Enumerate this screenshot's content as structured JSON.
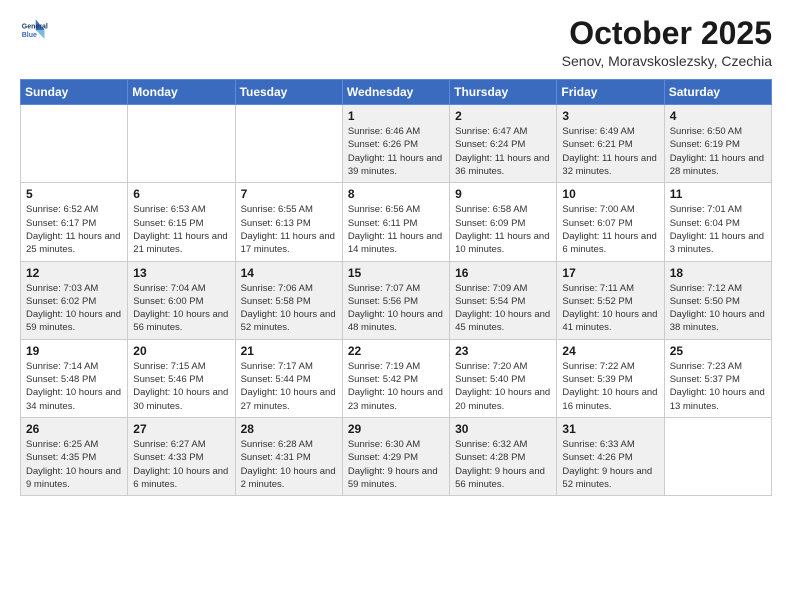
{
  "header": {
    "logo_line1": "General",
    "logo_line2": "Blue",
    "month": "October 2025",
    "location": "Senov, Moravskoslezsky, Czechia"
  },
  "weekdays": [
    "Sunday",
    "Monday",
    "Tuesday",
    "Wednesday",
    "Thursday",
    "Friday",
    "Saturday"
  ],
  "weeks": [
    [
      {
        "day": "",
        "info": ""
      },
      {
        "day": "",
        "info": ""
      },
      {
        "day": "",
        "info": ""
      },
      {
        "day": "1",
        "info": "Sunrise: 6:46 AM\nSunset: 6:26 PM\nDaylight: 11 hours\nand 39 minutes."
      },
      {
        "day": "2",
        "info": "Sunrise: 6:47 AM\nSunset: 6:24 PM\nDaylight: 11 hours\nand 36 minutes."
      },
      {
        "day": "3",
        "info": "Sunrise: 6:49 AM\nSunset: 6:21 PM\nDaylight: 11 hours\nand 32 minutes."
      },
      {
        "day": "4",
        "info": "Sunrise: 6:50 AM\nSunset: 6:19 PM\nDaylight: 11 hours\nand 28 minutes."
      }
    ],
    [
      {
        "day": "5",
        "info": "Sunrise: 6:52 AM\nSunset: 6:17 PM\nDaylight: 11 hours\nand 25 minutes."
      },
      {
        "day": "6",
        "info": "Sunrise: 6:53 AM\nSunset: 6:15 PM\nDaylight: 11 hours\nand 21 minutes."
      },
      {
        "day": "7",
        "info": "Sunrise: 6:55 AM\nSunset: 6:13 PM\nDaylight: 11 hours\nand 17 minutes."
      },
      {
        "day": "8",
        "info": "Sunrise: 6:56 AM\nSunset: 6:11 PM\nDaylight: 11 hours\nand 14 minutes."
      },
      {
        "day": "9",
        "info": "Sunrise: 6:58 AM\nSunset: 6:09 PM\nDaylight: 11 hours\nand 10 minutes."
      },
      {
        "day": "10",
        "info": "Sunrise: 7:00 AM\nSunset: 6:07 PM\nDaylight: 11 hours\nand 6 minutes."
      },
      {
        "day": "11",
        "info": "Sunrise: 7:01 AM\nSunset: 6:04 PM\nDaylight: 11 hours\nand 3 minutes."
      }
    ],
    [
      {
        "day": "12",
        "info": "Sunrise: 7:03 AM\nSunset: 6:02 PM\nDaylight: 10 hours\nand 59 minutes."
      },
      {
        "day": "13",
        "info": "Sunrise: 7:04 AM\nSunset: 6:00 PM\nDaylight: 10 hours\nand 56 minutes."
      },
      {
        "day": "14",
        "info": "Sunrise: 7:06 AM\nSunset: 5:58 PM\nDaylight: 10 hours\nand 52 minutes."
      },
      {
        "day": "15",
        "info": "Sunrise: 7:07 AM\nSunset: 5:56 PM\nDaylight: 10 hours\nand 48 minutes."
      },
      {
        "day": "16",
        "info": "Sunrise: 7:09 AM\nSunset: 5:54 PM\nDaylight: 10 hours\nand 45 minutes."
      },
      {
        "day": "17",
        "info": "Sunrise: 7:11 AM\nSunset: 5:52 PM\nDaylight: 10 hours\nand 41 minutes."
      },
      {
        "day": "18",
        "info": "Sunrise: 7:12 AM\nSunset: 5:50 PM\nDaylight: 10 hours\nand 38 minutes."
      }
    ],
    [
      {
        "day": "19",
        "info": "Sunrise: 7:14 AM\nSunset: 5:48 PM\nDaylight: 10 hours\nand 34 minutes."
      },
      {
        "day": "20",
        "info": "Sunrise: 7:15 AM\nSunset: 5:46 PM\nDaylight: 10 hours\nand 30 minutes."
      },
      {
        "day": "21",
        "info": "Sunrise: 7:17 AM\nSunset: 5:44 PM\nDaylight: 10 hours\nand 27 minutes."
      },
      {
        "day": "22",
        "info": "Sunrise: 7:19 AM\nSunset: 5:42 PM\nDaylight: 10 hours\nand 23 minutes."
      },
      {
        "day": "23",
        "info": "Sunrise: 7:20 AM\nSunset: 5:40 PM\nDaylight: 10 hours\nand 20 minutes."
      },
      {
        "day": "24",
        "info": "Sunrise: 7:22 AM\nSunset: 5:39 PM\nDaylight: 10 hours\nand 16 minutes."
      },
      {
        "day": "25",
        "info": "Sunrise: 7:23 AM\nSunset: 5:37 PM\nDaylight: 10 hours\nand 13 minutes."
      }
    ],
    [
      {
        "day": "26",
        "info": "Sunrise: 6:25 AM\nSunset: 4:35 PM\nDaylight: 10 hours\nand 9 minutes."
      },
      {
        "day": "27",
        "info": "Sunrise: 6:27 AM\nSunset: 4:33 PM\nDaylight: 10 hours\nand 6 minutes."
      },
      {
        "day": "28",
        "info": "Sunrise: 6:28 AM\nSunset: 4:31 PM\nDaylight: 10 hours\nand 2 minutes."
      },
      {
        "day": "29",
        "info": "Sunrise: 6:30 AM\nSunset: 4:29 PM\nDaylight: 9 hours\nand 59 minutes."
      },
      {
        "day": "30",
        "info": "Sunrise: 6:32 AM\nSunset: 4:28 PM\nDaylight: 9 hours\nand 56 minutes."
      },
      {
        "day": "31",
        "info": "Sunrise: 6:33 AM\nSunset: 4:26 PM\nDaylight: 9 hours\nand 52 minutes."
      },
      {
        "day": "",
        "info": ""
      }
    ]
  ]
}
